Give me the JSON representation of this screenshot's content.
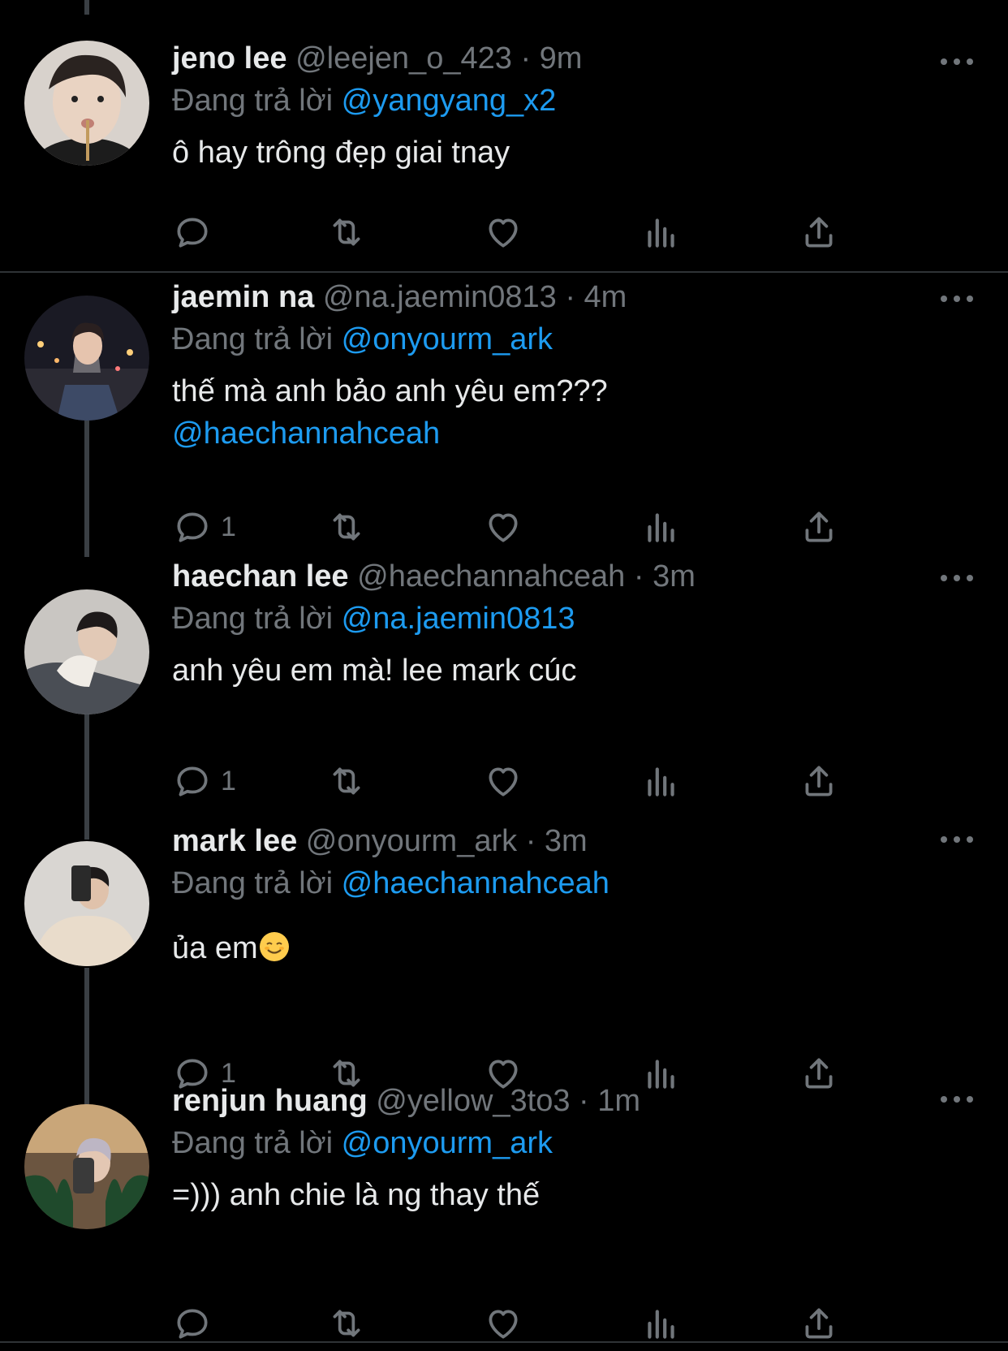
{
  "colors": {
    "background": "#000000",
    "text": "#e7e9ea",
    "muted": "#71767b",
    "accent": "#1d9bf0"
  },
  "reply_prefix": "Đang trả lời",
  "tweets": [
    {
      "display_name": "jeno lee",
      "handle": "@leejen_o_423",
      "separator": "·",
      "time": "9m",
      "reply_to": "@yangyang_x2",
      "text_line1": "ô hay trông đẹp giai tnay",
      "reply_count": ""
    },
    {
      "display_name": "jaemin na",
      "handle": "@na.jaemin0813",
      "separator": "·",
      "time": "4m",
      "reply_to": "@onyourm_ark",
      "text_line1": "thế mà anh bảo anh yêu em???",
      "text_mention": "@haechannahceah",
      "reply_count": "1"
    },
    {
      "display_name": "haechan lee",
      "handle": "@haechannahceah",
      "separator": "·",
      "time": "3m",
      "reply_to": "@na.jaemin0813",
      "text_line1": "anh yêu em mà! lee mark cúc",
      "reply_count": "1"
    },
    {
      "display_name": "mark lee",
      "handle": "@onyourm_ark",
      "separator": "·",
      "time": "3m",
      "reply_to": "@haechannahceah",
      "text_line1": "ủa em",
      "text_emoji": "smiling-face-emoji",
      "reply_count": "1"
    },
    {
      "display_name": "renjun huang",
      "handle": "@yellow_3to3",
      "separator": "·",
      "time": "1m",
      "reply_to": "@onyourm_ark",
      "text_line1": "=))) anh chie là ng thay thế",
      "reply_count": ""
    }
  ]
}
